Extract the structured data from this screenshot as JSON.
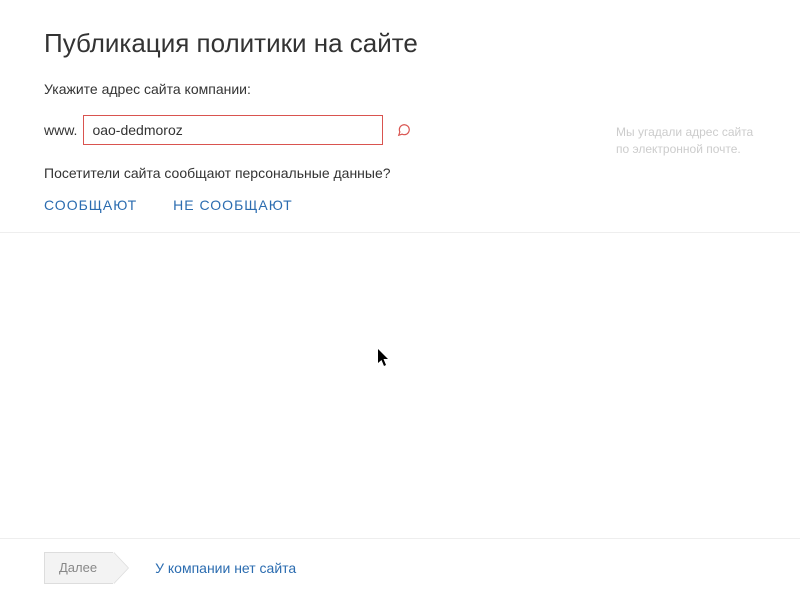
{
  "header": {
    "title": "Публикация политики на сайте"
  },
  "form": {
    "prompt": "Укажите адрес сайта компании:",
    "www_prefix": "www.",
    "site_value": "oao-dedmoroz",
    "hint": "Мы угадали адрес сайта по электронной почте.",
    "question": "Посетители сайта сообщают персональные данные?",
    "actions": {
      "yes": "СООБЩАЮТ",
      "no": "НЕ СООБЩАЮТ"
    }
  },
  "footer": {
    "next": "Далее",
    "no_site": "У компании нет сайта"
  },
  "colors": {
    "link": "#2b6cb0",
    "error": "#d9534f",
    "text": "#333333",
    "muted": "#cccccc"
  }
}
